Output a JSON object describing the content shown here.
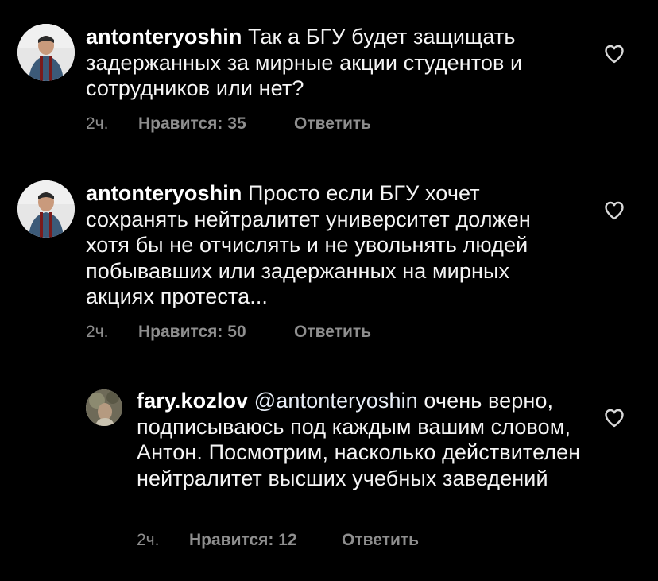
{
  "comments": [
    {
      "username": "antonteryoshin",
      "mention": "",
      "text": "Так а БГУ будет защищать задержанных за мирные акции студентов и сотрудников или нет?",
      "time": "2ч.",
      "likes": "Нравится: 35",
      "reply": "Ответить"
    },
    {
      "username": "antonteryoshin",
      "mention": "",
      "text": "Просто если БГУ хочет сохранять нейтралитет университет должен хотя бы не отчислять и не увольнять людей побывавших или задержанных на мирных акциях протеста...",
      "time": "2ч.",
      "likes": "Нравится: 50",
      "reply": "Ответить"
    },
    {
      "username": "fary.kozlov",
      "mention": "@antonteryoshin",
      "text": "очень верно, подписываюсь под каждым вашим словом, Антон. Посмотрим, насколько действителен нейтралитет высших учебных заведений",
      "time": "2ч.",
      "likes": "Нравится: 12",
      "reply": "Ответить"
    }
  ],
  "colors": {
    "background": "#000000",
    "text": "#f5f5f5",
    "meta": "#8e8e8e",
    "icon": "#d9d9d9"
  },
  "icons": {
    "like": "heart-outline-icon"
  }
}
